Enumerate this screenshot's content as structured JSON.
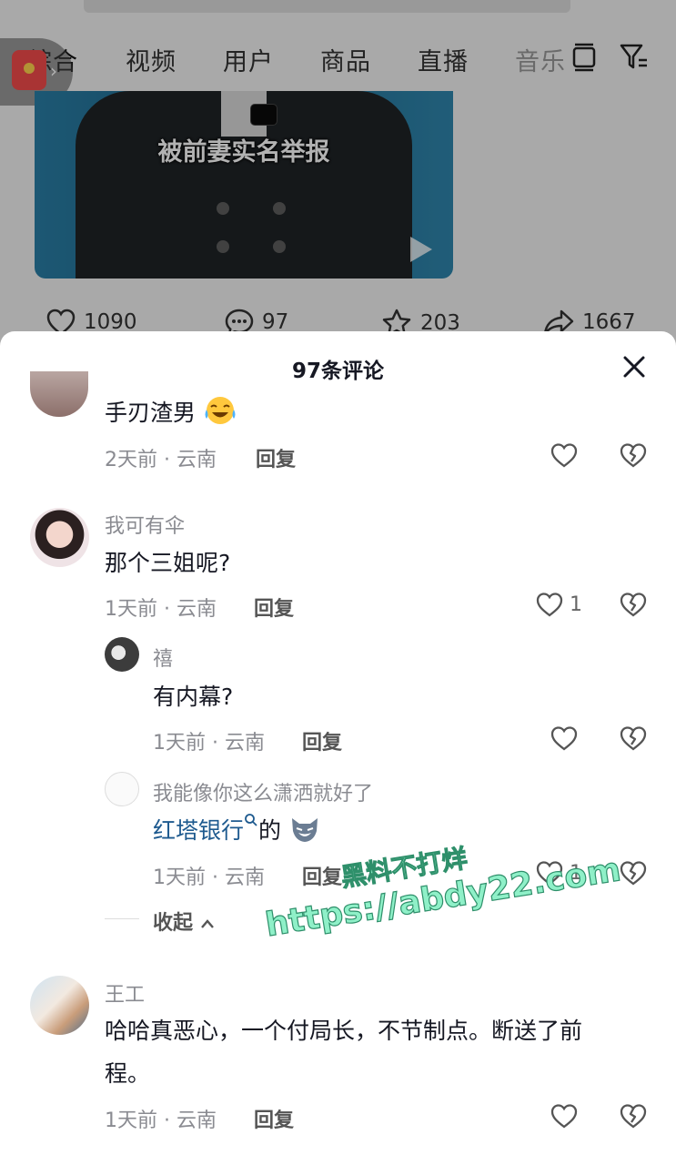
{
  "tabs": [
    "综合",
    "视频",
    "用户",
    "商品",
    "直播",
    "音乐"
  ],
  "video": {
    "caption": "被前妻实名举报"
  },
  "stats": {
    "likes": "1090",
    "comments": "97",
    "favorites": "203",
    "shares": "1667"
  },
  "sheet": {
    "title": "97条评论"
  },
  "comments": [
    {
      "text": "手刃渣男",
      "time": "2天前 · 云南",
      "reply_label": "回复",
      "like_count": ""
    },
    {
      "user": "我可有伞",
      "text": "那个三姐呢?",
      "time": "1天前 · 云南",
      "reply_label": "回复",
      "like_count": "1"
    },
    {
      "user": "禧",
      "text": "有内幕?",
      "time": "1天前 · 云南",
      "reply_label": "回复",
      "like_count": ""
    },
    {
      "user": "我能像你这么潇洒就好了",
      "link_text": "红塔银行",
      "text_suffix": "的",
      "time": "1天前 · 云南",
      "reply_label": "回复",
      "like_count": "1"
    },
    {
      "user": "王工",
      "text_line1": "哈哈真恶心，一个付局长，不节制点。断送了前",
      "text_line2": "程。",
      "time": "1天前 · 云南",
      "reply_label": "回复",
      "like_count": ""
    }
  ],
  "collapse_label": "收起",
  "watermark": {
    "line1": "黑料不打烊",
    "line2": "https://abdy22.com"
  }
}
